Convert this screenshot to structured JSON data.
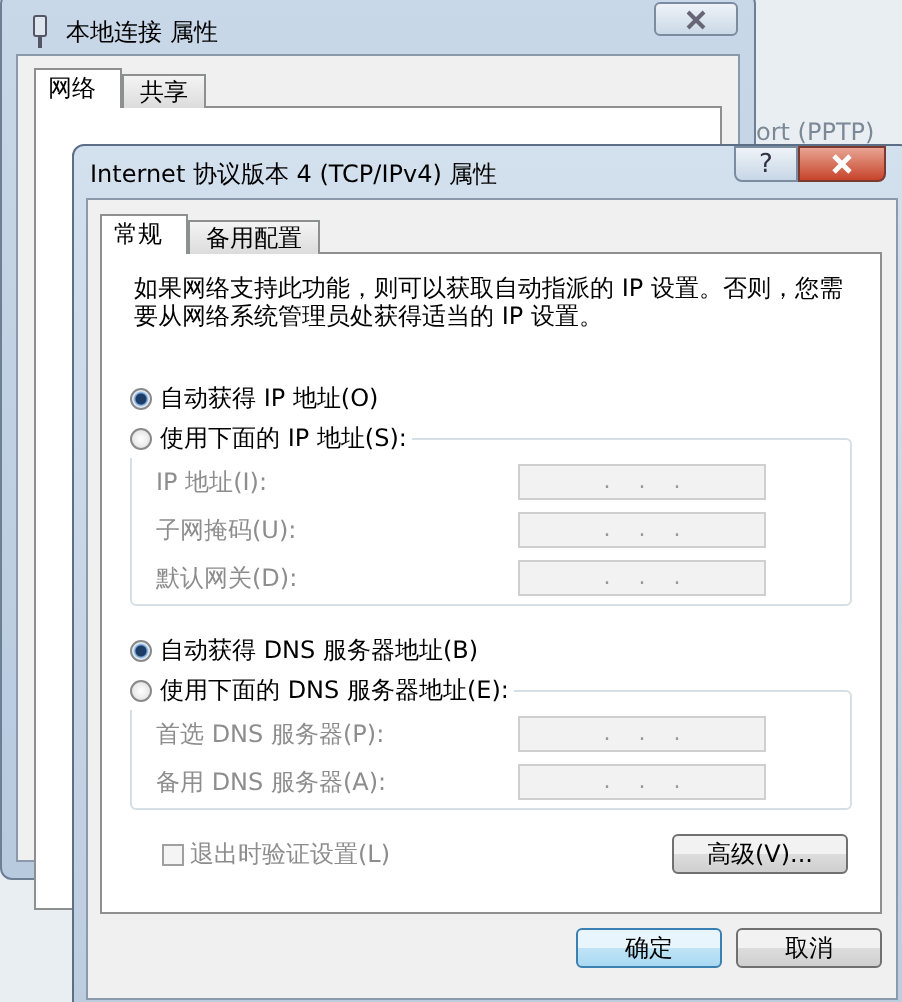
{
  "background_window": {
    "title": "本地连接 属性",
    "tabs": [
      {
        "label": "网络",
        "selected": true
      },
      {
        "label": "共享",
        "selected": false
      }
    ],
    "side_text": "ort (PPTP)"
  },
  "dialog": {
    "title": "Internet 协议版本 4 (TCP/IPv4) 属性",
    "help": "?",
    "tabs": [
      {
        "label": "常规",
        "selected": true
      },
      {
        "label": "备用配置",
        "selected": false
      }
    ],
    "description": "如果网络支持此功能，则可以获取自动指派的 IP 设置。否则，您需要从网络系统管理员处获得适当的 IP 设置。",
    "sections": [
      {
        "options": [
          {
            "label": "自动获得 IP 地址(O)",
            "selected": true
          },
          {
            "label": "使用下面的 IP 地址(S):",
            "selected": false
          }
        ],
        "disabled": true,
        "fields": [
          {
            "label": "IP 地址(I):",
            "value": ".    .    ."
          },
          {
            "label": "子网掩码(U):",
            "value": ".    .    ."
          },
          {
            "label": "默认网关(D):",
            "value": ".    .    ."
          }
        ]
      },
      {
        "options": [
          {
            "label": "自动获得 DNS 服务器地址(B)",
            "selected": true
          },
          {
            "label": "使用下面的 DNS 服务器地址(E):",
            "selected": false
          }
        ],
        "disabled": true,
        "fields": [
          {
            "label": "首选 DNS 服务器(P):",
            "value": ".    .    ."
          },
          {
            "label": "备用 DNS 服务器(A):",
            "value": ".    .    ."
          }
        ]
      }
    ],
    "validate": {
      "label": "退出时验证设置(L)",
      "checked": false,
      "disabled": true
    },
    "advanced_button": "高级(V)...",
    "buttons": [
      {
        "label": "确定",
        "default": true
      },
      {
        "label": "取消",
        "default": false
      }
    ]
  }
}
